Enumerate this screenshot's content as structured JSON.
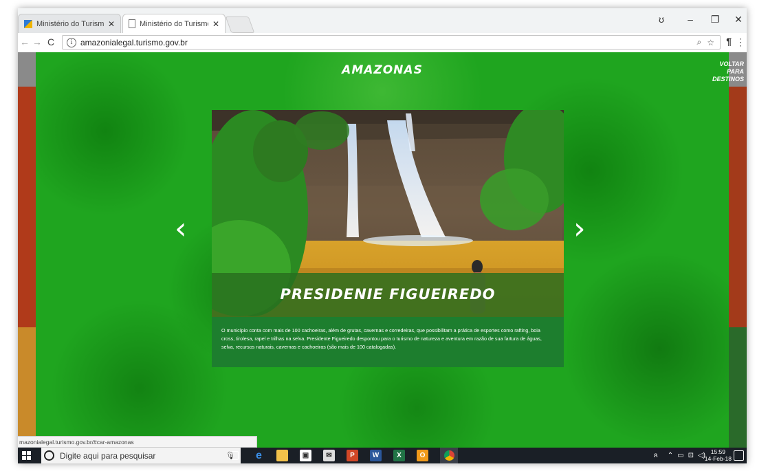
{
  "browser": {
    "tabs": [
      {
        "title": "Ministério do Turismo - /",
        "active": false
      },
      {
        "title": "Ministério do Turismo - /",
        "active": true
      }
    ],
    "url": "amazonialegal.turismo.gov.br",
    "status_url": "mazonialegal.turismo.gov.br/#car-amazonas"
  },
  "page": {
    "region_title": "AMAZONAS",
    "back_link_line1": "VOLTAR PARA",
    "back_link_line2": "DESTINOS",
    "prev_arrow": "‹",
    "next_arrow": "›",
    "destination": {
      "title": "PRESIDENIE FIGUEIREDO",
      "description": "O município conta com mais de 100 cachoeiras, além de grutas, cavernas e corredeiras, que possibilitam a prática de esportes como rafting, boia cross, tirolesa, rapel e trilhas na selva. Presidente Figueiredo despontou para o turismo de natureza e aventura em razão de sua fartura de águas, selva, recursos naturais, cavernas e cachoeiras (são mais de 100 catalogadas)."
    }
  },
  "taskbar": {
    "search_placeholder": "Digite aqui para pesquisar",
    "time": "15:59",
    "date": "14-Feb-18"
  },
  "colors": {
    "page_green": "#1fa51f",
    "description_green": "#1d7e2e",
    "taskbar": "#1a1f26"
  },
  "icons": [
    "windows-icon",
    "cortana-icon",
    "mic-icon",
    "task-view-icon",
    "edge-icon",
    "file-explorer-icon",
    "store-icon",
    "mail-icon",
    "powerpoint-icon",
    "word-icon",
    "excel-icon",
    "outlook-icon",
    "chrome-icon"
  ]
}
